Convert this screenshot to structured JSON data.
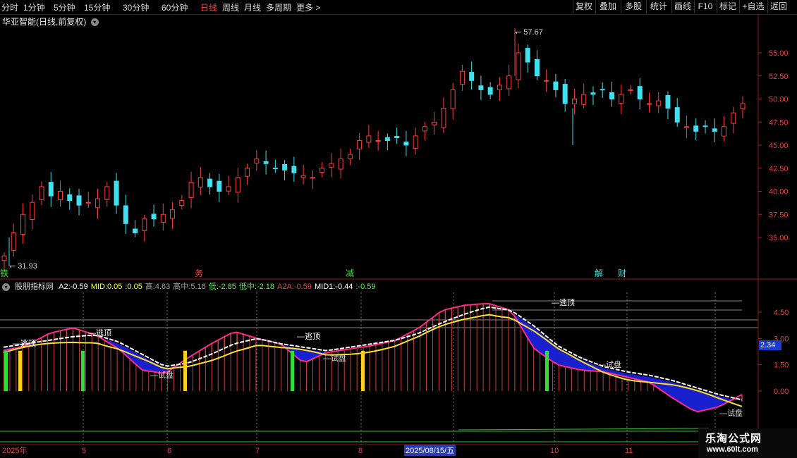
{
  "toolbar": {
    "periods": [
      "分时",
      "1分钟",
      "5分钟",
      "15分钟",
      "30分钟",
      "60分钟",
      "日线",
      "周线",
      "月线",
      "多周期",
      "更多 >"
    ],
    "active_period": "日线",
    "right_buttons": [
      "复权",
      "叠加",
      "多股",
      "统计",
      "画线",
      "F10",
      "标记",
      "+自选",
      "返回"
    ]
  },
  "main_chart": {
    "title": "华亚智能(日线,前复权)",
    "high_label": "57.67",
    "low_label": "31.93",
    "price_ticks": [
      "55.00",
      "52.50",
      "50.00",
      "47.50",
      "45.00",
      "42.50",
      "40.00",
      "37.50",
      "35.00"
    ],
    "bottom_tags": [
      {
        "text": "铁",
        "color": "#40e040"
      },
      {
        "text": "务",
        "color": "#ff4040"
      },
      {
        "text": "减",
        "color": "#40e040"
      },
      {
        "text": "解",
        "color": "#40e0e0"
      },
      {
        "text": "财",
        "color": "#40e0e0"
      }
    ]
  },
  "indicator": {
    "name": "股朋指标网",
    "values": [
      {
        "label": "A2:",
        "value": "-0.59",
        "color": "#ffffff"
      },
      {
        "label": "MID:",
        "value": "0.05",
        "color": "#ffff40"
      },
      {
        "label": ":",
        "value": "0.05",
        "color": "#ffff40"
      },
      {
        "label": "高:",
        "value": "4.63",
        "color": "#a0a0a0"
      },
      {
        "label": "高中:",
        "value": "5.18",
        "color": "#a0a0a0"
      },
      {
        "label": "低:",
        "value": "-2.85",
        "color": "#40ff40"
      },
      {
        "label": "低中:",
        "value": "-2.18",
        "color": "#40ff40"
      },
      {
        "label": "A2A:",
        "value": "-0.59",
        "color": "#ff4040"
      },
      {
        "label": "MID1:",
        "value": "-0.44",
        "color": "#ffffff"
      },
      {
        "label": ":",
        "value": "-0.59",
        "color": "#40ff40"
      }
    ],
    "axis_ticks": [
      "4.50",
      "3.00",
      "1.50",
      "0.00"
    ],
    "current_value": "2.34",
    "signals": {
      "top": "逃顶",
      "bottom": "试盘"
    }
  },
  "chart_data": {
    "type": "candlestick",
    "price_axis": {
      "min": 31.93,
      "max": 57.67,
      "ticks": [
        35,
        37.5,
        40,
        42.5,
        45,
        47.5,
        50,
        52.5,
        55
      ]
    },
    "close_series": [
      33.0,
      35.5,
      37.5,
      38.8,
      40.5,
      39.5,
      40.0,
      39.0,
      38.5,
      38.8,
      39.2,
      40.5,
      38.5,
      36.5,
      35.5,
      37.0,
      37.0,
      37.5,
      38.0,
      39.0,
      41.0,
      41.5,
      40.5,
      40.0,
      40.5,
      41.5,
      42.5,
      43.5,
      43.0,
      42.5,
      42.3,
      42.0,
      41.7,
      41.5,
      42.5,
      43.0,
      43.5,
      44.0,
      45.5,
      46.0,
      45.5,
      45.5,
      45.8,
      45.0,
      46.0,
      47.0,
      47.5,
      49.0,
      51.0,
      53.0,
      52.0,
      51.0,
      50.5,
      51.5,
      52.5,
      55.0,
      54.0,
      52.5,
      52.0,
      51.0,
      49.5,
      50.0,
      50.5,
      50.5,
      51.0,
      50.0,
      50.5,
      51.0,
      50.0,
      49.5,
      49.8,
      49.0,
      47.5,
      47.0,
      46.5,
      47.0,
      46.5,
      47.0,
      48.5,
      49.5
    ],
    "high": 57.67,
    "low": 31.93,
    "date_labels": [
      "2025年",
      "5",
      "6",
      "7",
      "8",
      "2025/08/15/五",
      "10",
      "11"
    ]
  }
}
